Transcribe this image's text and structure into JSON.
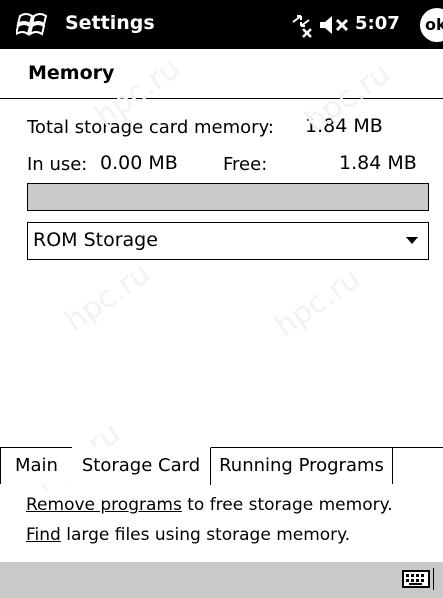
{
  "titlebar": {
    "title": "Settings",
    "clock": "5:07",
    "ok_label": "ok"
  },
  "header": {
    "title": "Memory"
  },
  "memory": {
    "total_label": "Total storage card memory:",
    "total_value": "1.84 MB",
    "in_use_label": "In use:",
    "in_use_value": "0.00 MB",
    "free_label": "Free:",
    "free_value": "1.84 MB",
    "usage_fraction": 0
  },
  "storage_select": {
    "selected": "ROM Storage"
  },
  "tabs": [
    {
      "label": "Main",
      "active": false
    },
    {
      "label": "Storage Card",
      "active": true
    },
    {
      "label": "Running Programs",
      "active": false
    }
  ],
  "links": {
    "remove_link": "Remove programs",
    "remove_rest": " to free storage memory.",
    "find_link": "Find",
    "find_rest": " large files using storage memory."
  },
  "watermark": "hpc.ru",
  "colors": {
    "titlebar_bg": "#000000",
    "bar_fill": "#c9c9c9",
    "background": "#ffffff"
  }
}
